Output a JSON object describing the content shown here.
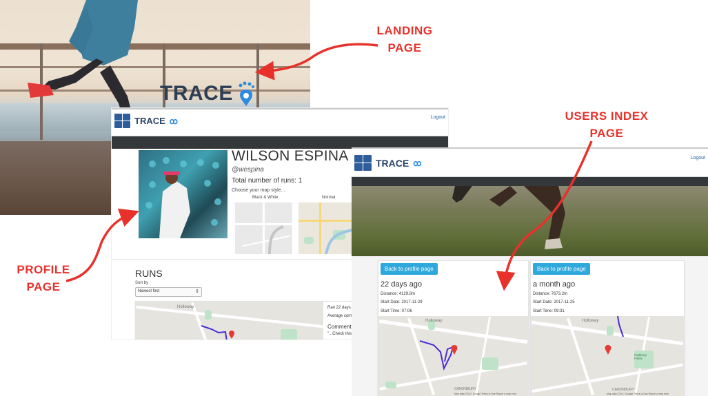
{
  "annotations": {
    "landing_line1": "LANDING",
    "landing_line2": "PAGE",
    "users_index_line1": "USERS INDEX",
    "users_index_line2": "PAGE",
    "profile_line1": "PROFILE",
    "profile_line2": "PAGE"
  },
  "landing": {
    "brand": "TRACE"
  },
  "profile": {
    "brand": "TRACE",
    "logout": "Logout",
    "name": "WILSON ESPINA",
    "handle": "@wespina",
    "total_runs": "Total number of runs: 1",
    "map_style_prompt": "Choose your map style...",
    "map_styles": [
      "Black & White",
      "Normal"
    ],
    "runs_heading": "RUNS",
    "sort_label": "Sort by",
    "sort_selected": "Newest first",
    "run_info_ran": "Ran 22 days ag",
    "run_info_avg": "Average comm",
    "run_info_comments": "Comments",
    "run_info_comment_text": "\"...Check this o",
    "map_label_holloway": "Holloway"
  },
  "users_index": {
    "brand": "TRACE",
    "logout": "Logout",
    "cards": [
      {
        "button": "Back to profile page",
        "title": "22 days ago",
        "distance": "Distance: 4129.8m",
        "start_date": "Start Date: 2017-11-29",
        "start_time": "Start Time: 07:06",
        "map_label_top": "Holloway",
        "map_label_bottom": "CANONBURY",
        "map_footer": "Map data ©2017 Google   Terms of Use   Report a map error"
      },
      {
        "button": "Back to profile page",
        "title": "a month ago",
        "distance": "Distance: 7673.2m",
        "start_date": "Start Date: 2017-11-25",
        "start_time": "Start Time: 09:31",
        "map_label_top": "Holloway",
        "map_label_bottom": "CANONBURY",
        "map_label_park": "Highbury Fields",
        "map_footer": "Map data ©2017 Google   Terms of Use   Report a map error"
      }
    ]
  },
  "colors": {
    "annotation_red": "#e8312a",
    "brand_navy": "#2a4465",
    "brand_blue": "#2d5d9a",
    "button_blue": "#2fa8dc",
    "dark_bar": "#35383b",
    "route_purple": "#4a2bd8"
  }
}
